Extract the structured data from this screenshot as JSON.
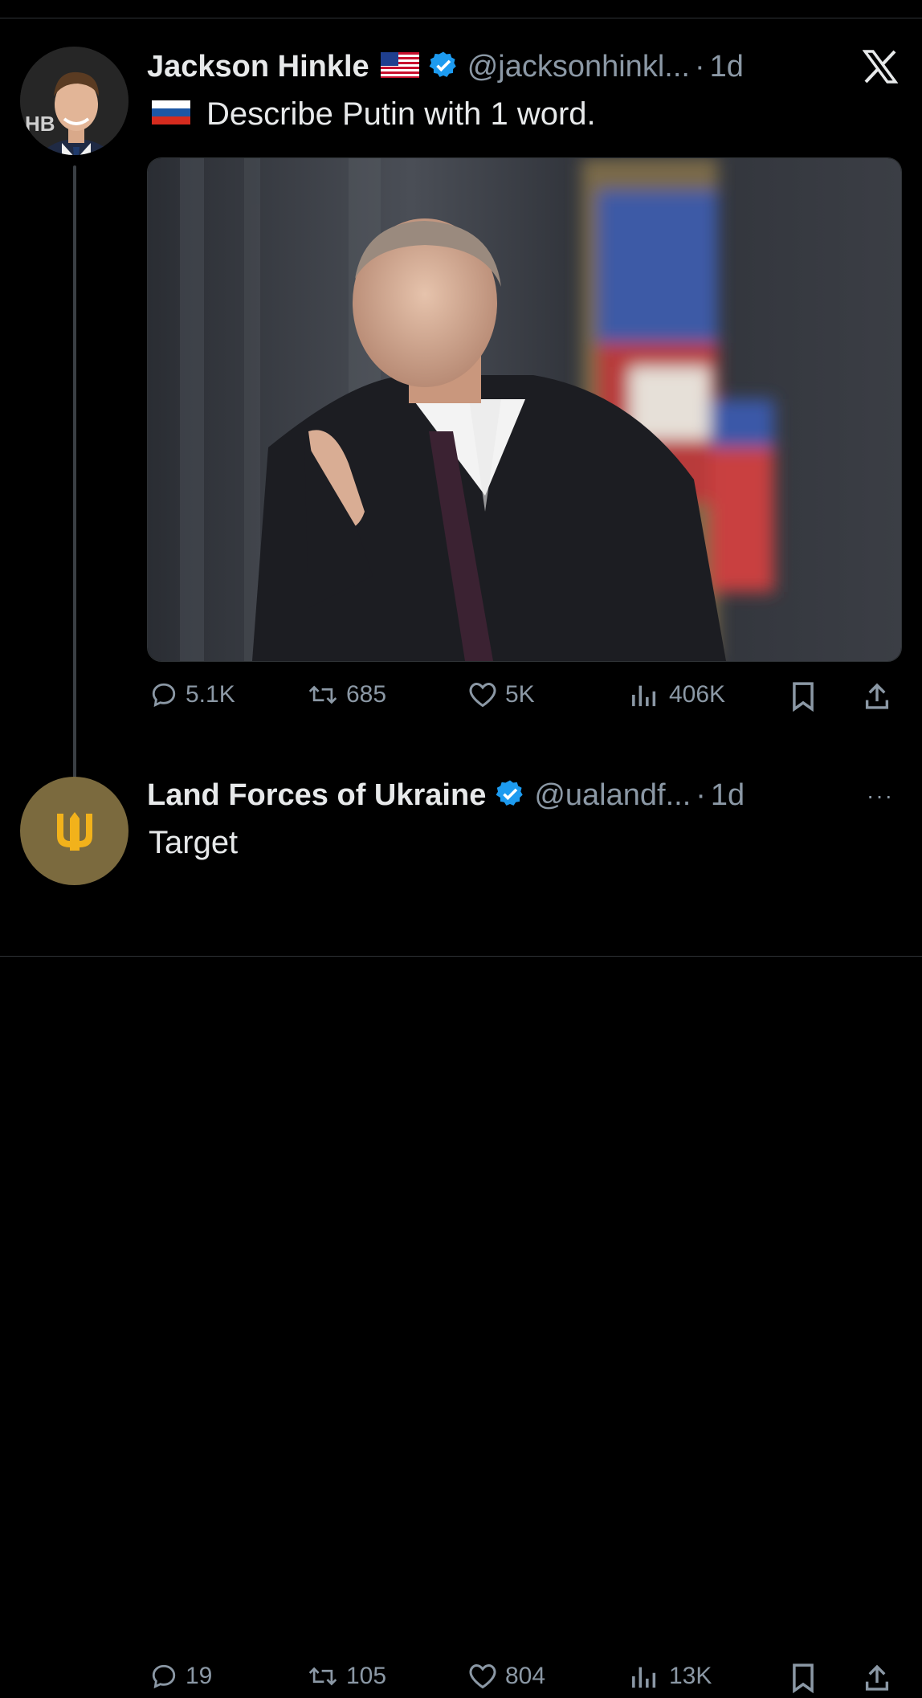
{
  "tweet1": {
    "name": "Jackson Hinkle",
    "handle": "@jacksonhinkl...",
    "time": "1d",
    "text": "Describe Putin with 1 word.",
    "avatar_text": "HB",
    "stats": {
      "replies": "5.1K",
      "reposts": "685",
      "likes": "5K",
      "views": "406K"
    }
  },
  "tweet2": {
    "name": "Land Forces of Ukraine",
    "handle": "@ualandf...",
    "time": "1d",
    "text": "Target",
    "more": "···",
    "stats": {
      "replies": "19",
      "reposts": "105",
      "likes": "804",
      "views": "13K"
    }
  },
  "separator": "·",
  "icons": [
    "reply-icon",
    "repost-icon",
    "like-icon",
    "views-icon",
    "bookmark-icon",
    "share-icon",
    "verified-badge-icon",
    "x-logo-icon",
    "us-flag-icon",
    "russia-flag-icon",
    "trident-icon"
  ],
  "colors": {
    "background": "#000000",
    "text": "#e7e9ea",
    "muted": "#8b98a5",
    "verified": "#1d9bf0",
    "badge_bg": "#7b6a3e",
    "trident": "#f2b21b"
  }
}
